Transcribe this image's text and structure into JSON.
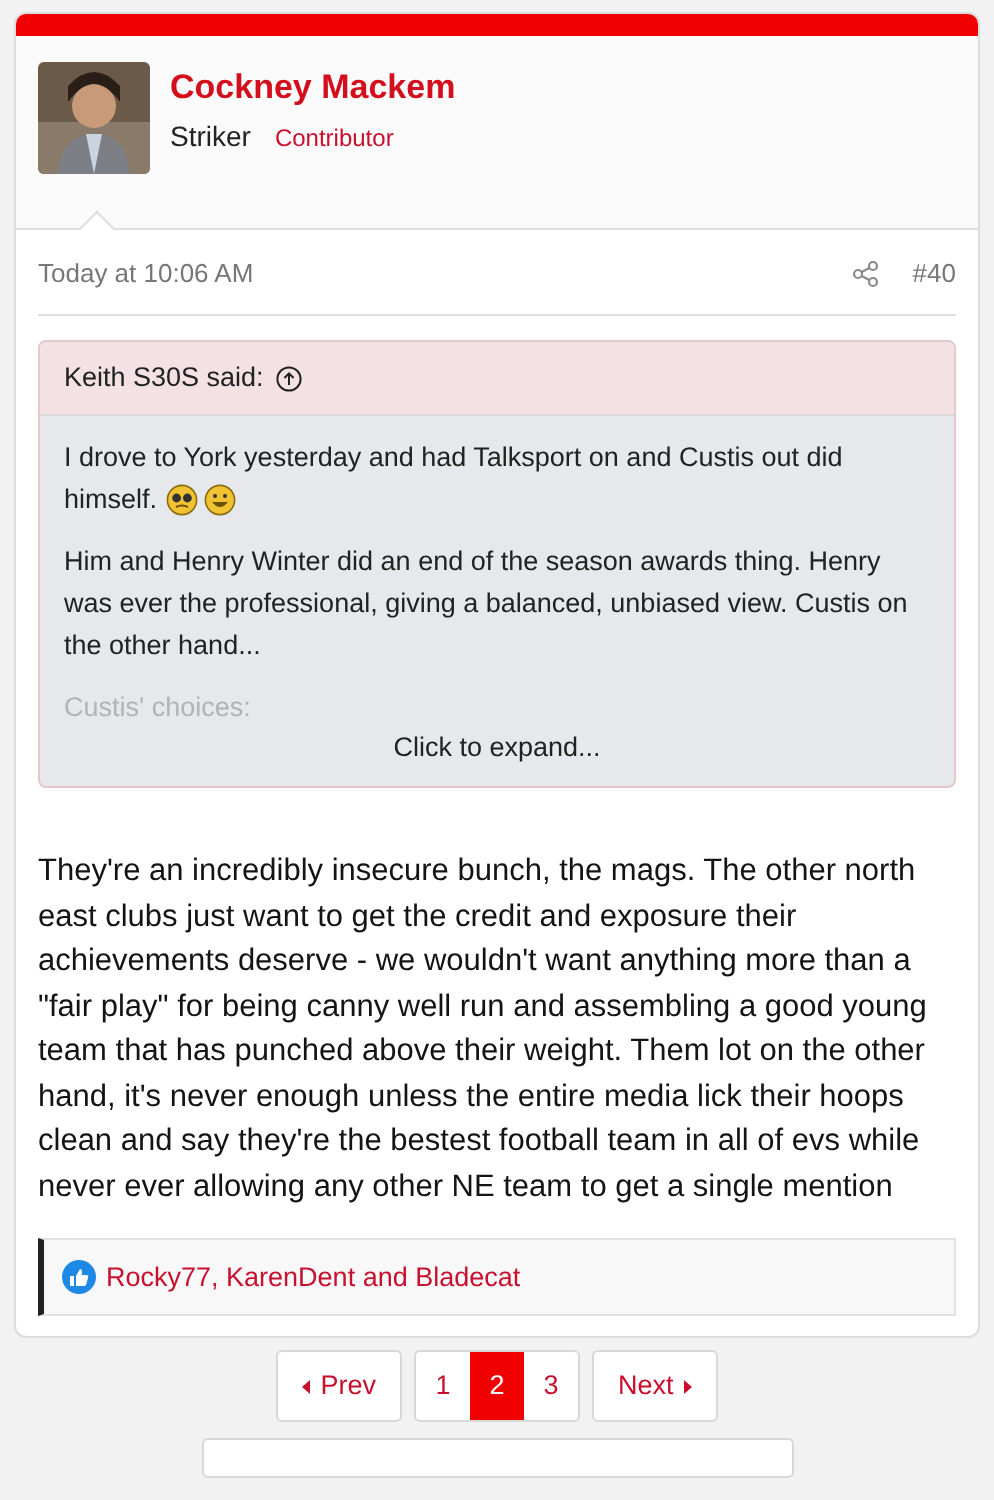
{
  "author": {
    "name": "Cockney Mackem",
    "title": "Striker",
    "banner": "Contributor"
  },
  "post_meta": {
    "time": "Today at 10:06 AM",
    "number": "#40"
  },
  "quote": {
    "attribution": "Keith S30S said:",
    "paragraphs": [
      "I drove to York yesterday and had Talksport on and Custis out did himself.",
      "Him and Henry Winter did an end of the season awards thing. Henry was ever the professional, giving a balanced, unbiased view. Custis on the other hand..."
    ],
    "faded_text": "Custis' choices:",
    "expand": "Click to expand..."
  },
  "body": "They're an incredibly insecure bunch, the mags. The other north east clubs just want to get the credit and exposure their achievements deserve - we wouldn't want anything more than a \"fair play\" for being canny well run and assembling a good young team that has punched above their weight. Them lot on the other hand, it's never enough unless the entire media lick their hoops clean and say they're the bestest football team in all of evs while never ever allowing any other NE team to get a single mention",
  "reactions": {
    "text": "Rocky77, KarenDent and Bladecat"
  },
  "pagination": {
    "prev": "Prev",
    "next": "Next",
    "pages": [
      {
        "label": "1",
        "selected": false
      },
      {
        "label": "2",
        "selected": true
      },
      {
        "label": "3",
        "selected": false
      }
    ]
  }
}
